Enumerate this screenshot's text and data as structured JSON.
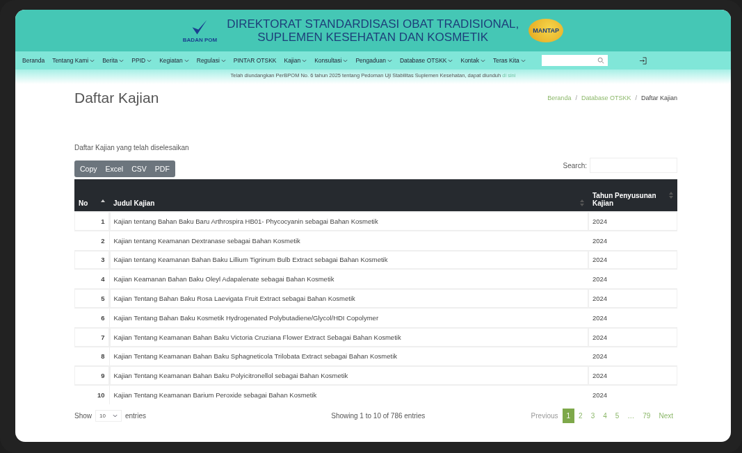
{
  "header": {
    "logo_left_text": "BADAN POM",
    "title_line_1": "DIREKTORAT STANDARDISASI OBAT TRADISIONAL,",
    "title_line_2": "SUPLEMEN KESEHATAN DAN KOSMETIK",
    "logo_right_text": "MANTAP"
  },
  "nav": {
    "items": [
      {
        "label": "Beranda",
        "has_menu": false
      },
      {
        "label": "Tentang Kami",
        "has_menu": true
      },
      {
        "label": "Berita",
        "has_menu": true
      },
      {
        "label": "PPID",
        "has_menu": true
      },
      {
        "label": "Kegiatan",
        "has_menu": true
      },
      {
        "label": "Regulasi",
        "has_menu": true
      },
      {
        "label": "PINTAR OTSKK",
        "has_menu": false
      },
      {
        "label": "Kajian",
        "has_menu": true
      },
      {
        "label": "Konsultasi",
        "has_menu": true
      },
      {
        "label": "Pengaduan",
        "has_menu": true
      },
      {
        "label": "Database OTSKK",
        "has_menu": true
      },
      {
        "label": "Kontak",
        "has_menu": true
      },
      {
        "label": "Teras Kita",
        "has_menu": true
      }
    ]
  },
  "announcement": {
    "text": "Telah diundangkan PerBPOM No. 6 tahun 2025 tentang Pedoman Uji Stabilitas Suplemen Kesehatan, dapat diunduh",
    "link": "di sini"
  },
  "page_title": "Daftar Kajian",
  "breadcrumb_separator": "/",
  "breadcrumb": [
    {
      "label": "Beranda",
      "link": true
    },
    {
      "label": "Database OTSKK",
      "link": true
    },
    {
      "label": "Daftar Kajian",
      "link": false
    }
  ],
  "description": "Daftar Kajian yang telah diselesaikan",
  "export_buttons": [
    "Copy",
    "Excel",
    "CSV",
    "PDF"
  ],
  "search_label": "Search:",
  "table": {
    "columns": [
      {
        "label": "No",
        "sorted": true
      },
      {
        "label": "Judul Kajian",
        "sorted": false
      },
      {
        "label": "Tahun Penyusunan Kajian",
        "sorted": false
      }
    ],
    "rows": [
      [
        "1",
        "Kajian tentang Bahan Baku Baru Arthrospira HB01- Phycocyanin sebagai Bahan Kosmetik",
        "2024"
      ],
      [
        "2",
        "Kajian tentang Keamanan Dextranase sebagai Bahan Kosmetik",
        "2024"
      ],
      [
        "3",
        "Kajian tentang Keamanan Bahan Baku Lillium Tigrinum Bulb Extract sebagai Bahan Kosmetik",
        "2024"
      ],
      [
        "4",
        "Kajian Keamanan Bahan Baku Oleyl Adapalenate sebagai Bahan Kosmetik",
        "2024"
      ],
      [
        "5",
        "Kajian Tentang Bahan Baku Rosa Laevigata Fruit Extract sebagai Bahan Kosmetik",
        "2024"
      ],
      [
        "6",
        "Kajian Tentang Bahan Baku Kosmetik Hydrogenated Polybutadiene/Glycol/HDI Copolymer",
        "2024"
      ],
      [
        "7",
        "Kajian Tentang Keamanan Bahan Baku Victoria Cruziana Flower Extract Sebagai Bahan Kosmetik",
        "2024"
      ],
      [
        "8",
        "Kajian Tentang Keamanan Bahan Baku Sphagneticola Trilobata Extract sebagai Bahan Kosmetik",
        "2024"
      ],
      [
        "9",
        "Kajian Tentang Keamanan Bahan Baku Polyicitronellol sebagai Bahan Kosmetik",
        "2024"
      ],
      [
        "10",
        "Kajian Tentang Keamanan Barium Peroxide sebagai Bahan Kosmetik",
        "2024"
      ]
    ]
  },
  "length": {
    "before": "Show",
    "value": "10",
    "after": "entries"
  },
  "info": "Showing 1 to 10 of 786 entries",
  "pagination": [
    {
      "label": "Previous",
      "selected": false
    },
    {
      "label": "1",
      "selected": true
    },
    {
      "label": "2",
      "selected": false
    },
    {
      "label": "3",
      "selected": false
    },
    {
      "label": "4",
      "selected": false
    },
    {
      "label": "5",
      "selected": false
    },
    {
      "label": "…",
      "selected": false
    },
    {
      "label": "79",
      "selected": false
    },
    {
      "label": "Next",
      "selected": false
    }
  ]
}
